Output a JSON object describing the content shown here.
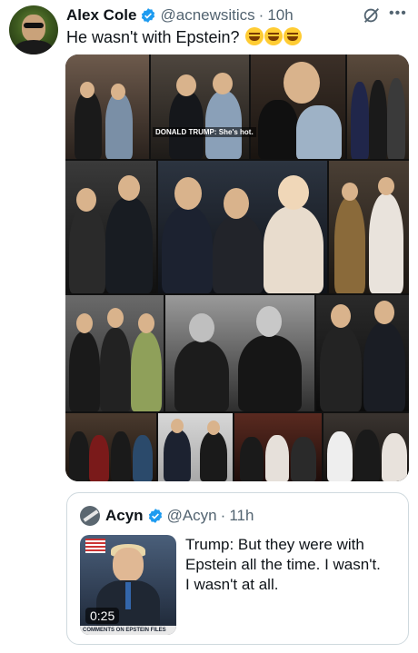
{
  "tweet": {
    "author_name": "Alex Cole",
    "author_handle": "@acnewsitics",
    "separator": "·",
    "time": "10h",
    "text": "He wasn't with Epstein?",
    "emoji": [
      "rofl-emoji",
      "rofl-emoji",
      "rofl-emoji"
    ],
    "media": {
      "overlay_caption": "DONALD TRUMP: She's hot."
    }
  },
  "quote": {
    "author_name": "Acyn",
    "author_handle": "@Acyn",
    "separator": "·",
    "time": "11h",
    "text": "Trump: But they were with\nEpstein all the time. I wasn't.\nI wasn't at all.",
    "video": {
      "duration": "0:25",
      "lower_third": "COMMENTS ON EPSTEIN FILES"
    }
  },
  "colors": {
    "verified": "#1d9bf0",
    "text": "#0f1419",
    "secondary": "#536471",
    "border": "#cfd9de"
  }
}
